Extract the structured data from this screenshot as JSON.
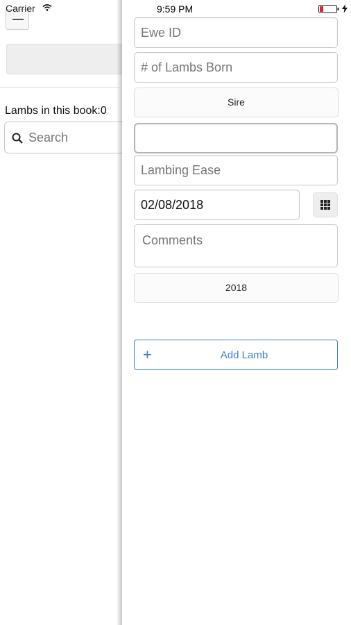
{
  "status_bar": {
    "carrier": "Carrier",
    "time": "9:59 PM",
    "battery_color": "#e0242a"
  },
  "background_page": {
    "lamb_count_text": "Lambs in this book:0",
    "search_placeholder": "Search"
  },
  "form": {
    "ewe_id_placeholder": "Ewe ID",
    "lambs_born_placeholder": "# of Lambs Born",
    "sire_label": "Sire",
    "empty_field_value": "",
    "lambing_ease_placeholder": "Lambing Ease",
    "date_value": "02/08/2018",
    "comments_placeholder": "Comments",
    "year_label": "2018",
    "add_lamb_label": "Add Lamb",
    "accent_color": "#3b7fd6"
  }
}
